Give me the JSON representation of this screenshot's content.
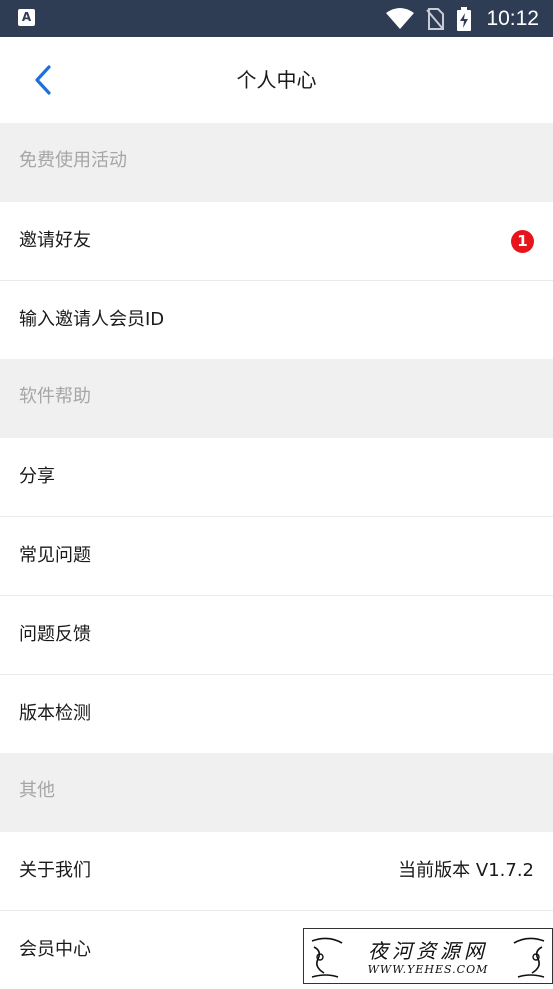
{
  "status_bar": {
    "time": "10:12",
    "app_icon_letter": "A",
    "icons": [
      "app-icon",
      "wifi-icon",
      "no-sim-icon",
      "battery-charging-icon"
    ]
  },
  "header": {
    "title": "个人中心",
    "back_icon": "chevron-left-icon",
    "accent": "#1e6fd9"
  },
  "sections": [
    {
      "title": "免费使用活动",
      "items": [
        {
          "label": "邀请好友",
          "badge": "1"
        },
        {
          "label": "输入邀请人会员ID"
        }
      ]
    },
    {
      "title": "软件帮助",
      "items": [
        {
          "label": "分享"
        },
        {
          "label": "常见问题"
        },
        {
          "label": "问题反馈"
        },
        {
          "label": "版本检测"
        }
      ]
    },
    {
      "title": "其他",
      "items": [
        {
          "label": "关于我们",
          "value": "当前版本 V1.7.2"
        },
        {
          "label": "会员中心"
        }
      ]
    }
  ],
  "watermark": {
    "text": "夜河资源网",
    "url": "WWW.YEHES.COM"
  },
  "colors": {
    "status_bar": "#2f3d54",
    "badge": "#e8141c",
    "section_header_text": "#a6a6a6",
    "section_header_bg": "#f0f0f0"
  }
}
